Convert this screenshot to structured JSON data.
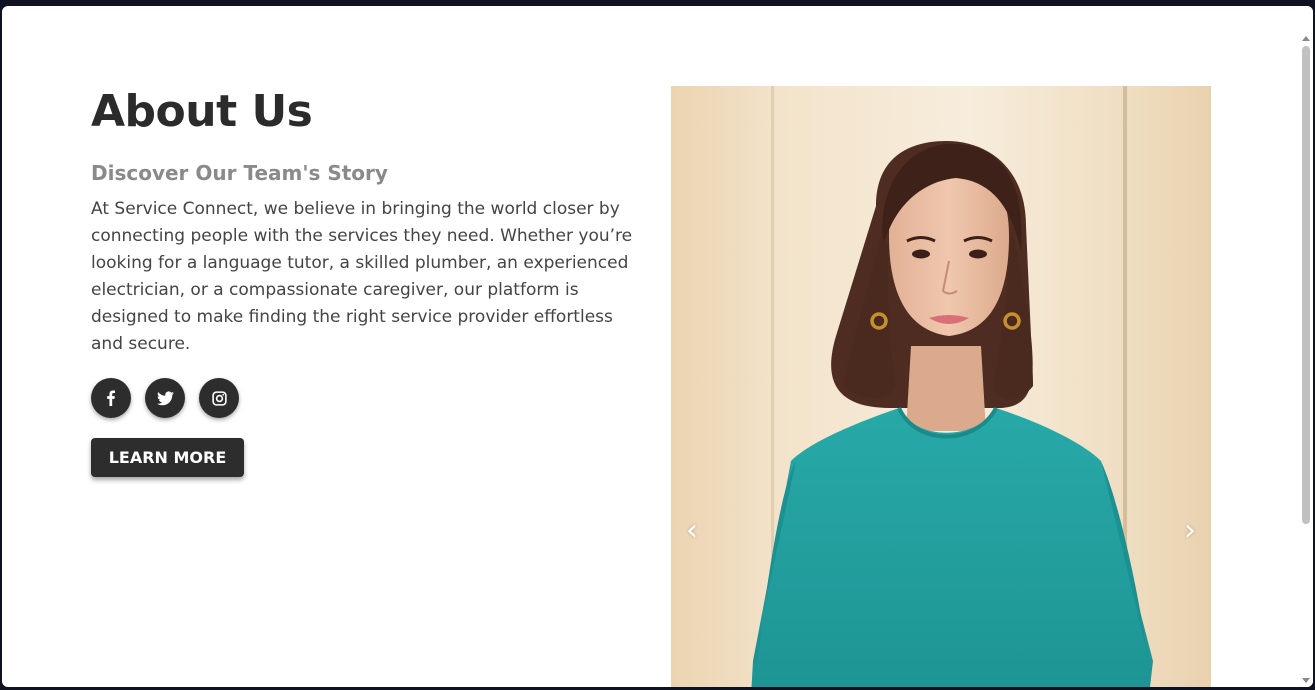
{
  "about": {
    "title": "About Us",
    "subtitle": "Discover Our Team's Story",
    "body": "At Service Connect, we believe in bringing the world closer by connecting people with the services they need. Whether you’re looking for a language tutor, a skilled plumber, an experienced electrician, or a compassionate caregiver, our platform is designed to make finding the right service provider effortless and secure."
  },
  "social": [
    {
      "icon": "facebook-icon"
    },
    {
      "icon": "twitter-icon"
    },
    {
      "icon": "instagram-icon"
    }
  ],
  "cta": {
    "label": "LEARN MORE"
  },
  "carousel": {
    "prev_glyph": "‹",
    "next_glyph": "›"
  },
  "colors": {
    "heading": "#2b2b2b",
    "subheading": "#8a8a8a",
    "button_bg": "#2d2d2d",
    "shirt": "#23a0a0"
  }
}
